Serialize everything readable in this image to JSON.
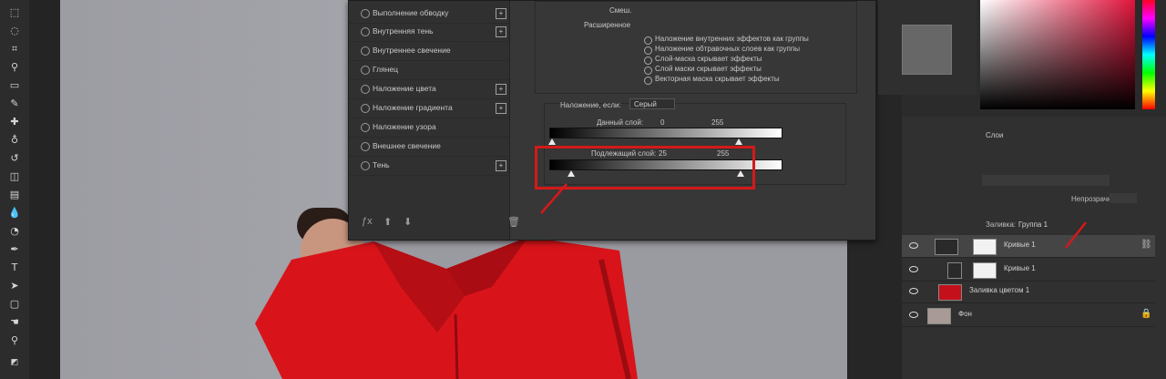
{
  "toolbar": {
    "tools": [
      "marquee-tool",
      "lasso-tool",
      "crop-tool",
      "eyedropper-tool",
      "frame-tool",
      "brush-tool",
      "healing-tool",
      "clone-tool",
      "history-brush-tool",
      "eraser-tool",
      "gradient-tool",
      "blur-tool",
      "dodge-tool",
      "pen-tool",
      "text-tool",
      "path-selection-tool",
      "shape-tool",
      "hand-tool",
      "zoom-tool"
    ]
  },
  "layer_style": {
    "styles": [
      {
        "label": "Выполнение обводку",
        "has_plus": true
      },
      {
        "label": "Внутренняя тень",
        "has_plus": true
      },
      {
        "label": "Внутреннее свечение",
        "has_plus": false
      },
      {
        "label": "Глянец",
        "has_plus": false
      },
      {
        "label": "Наложение цвета",
        "has_plus": true
      },
      {
        "label": "Наложение градиента",
        "has_plus": true
      },
      {
        "label": "Наложение узора",
        "has_plus": false
      },
      {
        "label": "Внешнее свечение",
        "has_plus": false
      },
      {
        "label": "Тень",
        "has_plus": true
      }
    ],
    "footer_icons": [
      "fx-icon",
      "up-arrow-icon",
      "down-arrow-icon",
      "trash-icon"
    ],
    "blend_options": {
      "top_line": "Смеш.",
      "advanced_label": "Расширенное",
      "checks": [
        "Наложение внутренних эффектов как группы",
        "Наложение обтравочных слоев как группы",
        "Слой-маска скрывает эффекты",
        "Слой маски скрывает эффекты",
        "Векторная маска скрывает эффекты"
      ],
      "blend_if_label": "Наложение, если:",
      "blend_if_value": "Серый",
      "this_layer_label": "Данный слой:",
      "this_layer_low": "0",
      "this_layer_high": "255",
      "underlying_label": "Подлежащий слой:",
      "underlying_low": "25",
      "underlying_high": "255"
    }
  },
  "layers_panel": {
    "header": "Слои",
    "opacity_label": "Непрозрачность:",
    "fill_label": "Заливка:",
    "group_label": "Группа 1",
    "rows": [
      {
        "name": "Кривые 1",
        "thumb": "white"
      },
      {
        "name": "Кривые 1",
        "thumb": "white"
      },
      {
        "name": "Заливка цветом 1",
        "thumb": "red"
      },
      {
        "name": "Фон",
        "thumb": "photo"
      }
    ]
  },
  "colors": {
    "highlight": "#d41919",
    "shirt": "#d8141a",
    "canvas": "#9a9aa1"
  }
}
